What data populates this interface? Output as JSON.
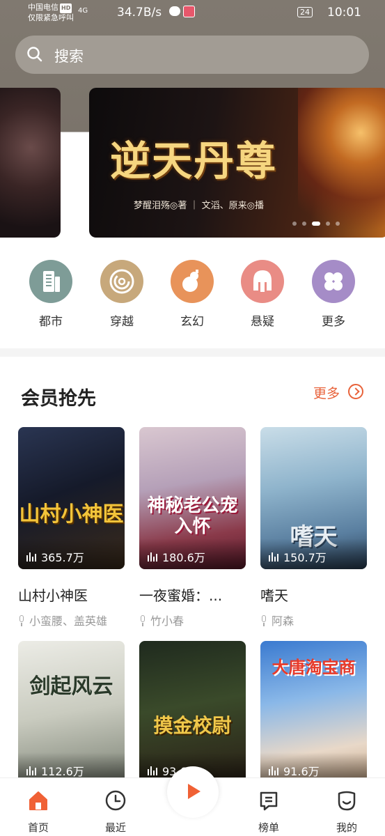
{
  "status_bar": {
    "carrier": "中国电信",
    "hd_badge": "HD",
    "emergency": "仅限紧急呼叫",
    "signal": "4G",
    "speed": "34.7B/s",
    "battery": "24",
    "time": "10:01"
  },
  "search": {
    "placeholder": "搜索"
  },
  "banner": {
    "title": "逆天丹尊",
    "credit": "梦醒泪殇◎著 ｜ 文滔、原来◎播",
    "dots": 5,
    "active_dot": 2
  },
  "categories": [
    {
      "label": "都市",
      "color": "#7e9c97",
      "icon": "building-icon"
    },
    {
      "label": "穿越",
      "color": "#c7a87b",
      "icon": "spiral-icon"
    },
    {
      "label": "玄幻",
      "color": "#e8935a",
      "icon": "gourd-icon"
    },
    {
      "label": "悬疑",
      "color": "#e98c85",
      "icon": "helmet-icon"
    },
    {
      "label": "更多",
      "color": "#a58cc7",
      "icon": "grid-icon"
    }
  ],
  "section": {
    "title": "会员抢先",
    "more_label": "更多"
  },
  "books": [
    {
      "title": "山村小神医",
      "author": "小蛮腰、盖英雄",
      "plays": "365.7万",
      "cover_text": "山村小神医"
    },
    {
      "title": "一夜蜜婚：...",
      "author": "竹小春",
      "plays": "180.6万",
      "cover_text": "神秘老公宠入怀"
    },
    {
      "title": "嗜天",
      "author": "阿森",
      "plays": "150.7万",
      "cover_text": "嗜天"
    },
    {
      "title": "",
      "author": "",
      "plays": "112.6万",
      "cover_text": "剑起风云"
    },
    {
      "title": "",
      "author": "",
      "plays": "93.6万",
      "cover_text": "摸金校尉"
    },
    {
      "title": "",
      "author": "",
      "plays": "91.6万",
      "cover_text": "大唐淘宝商"
    }
  ],
  "nav": [
    {
      "label": "首页",
      "icon": "home-icon"
    },
    {
      "label": "最近",
      "icon": "clock-icon"
    },
    {
      "label": "榜单",
      "icon": "list-icon"
    },
    {
      "label": "我的",
      "icon": "face-icon"
    }
  ],
  "colors": {
    "accent": "#f06135",
    "header": "#7b746b"
  }
}
